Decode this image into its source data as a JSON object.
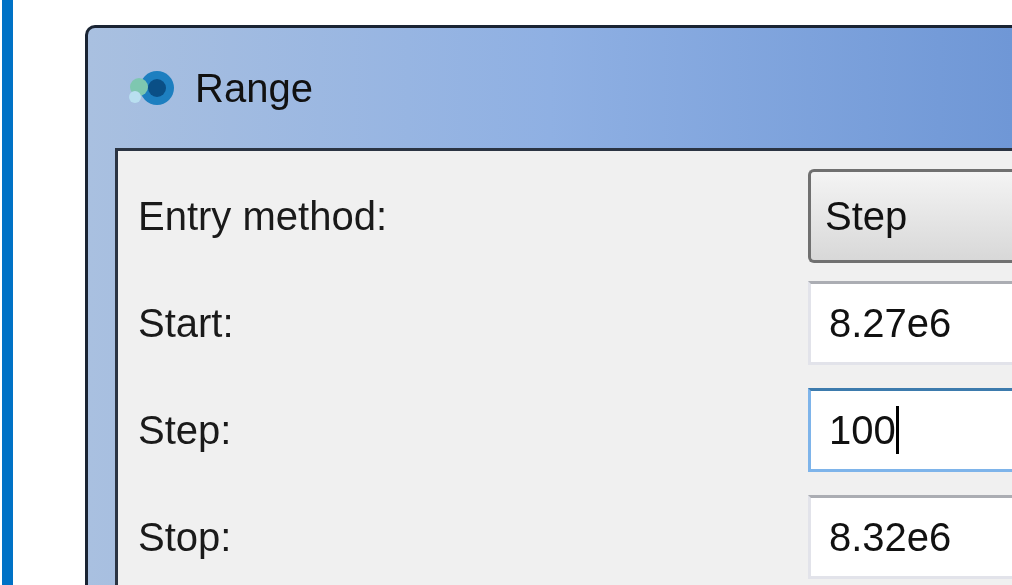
{
  "window": {
    "title": "Range"
  },
  "fields": [
    {
      "label": "Entry method:",
      "kind": "dropdown",
      "value": "Step"
    },
    {
      "label": "Start:",
      "kind": "text",
      "value": "8.27e6",
      "focused": false
    },
    {
      "label": "Step:",
      "kind": "text",
      "value": "100",
      "focused": true
    },
    {
      "label": "Stop:",
      "kind": "text",
      "value": "8.32e6",
      "focused": false
    }
  ]
}
